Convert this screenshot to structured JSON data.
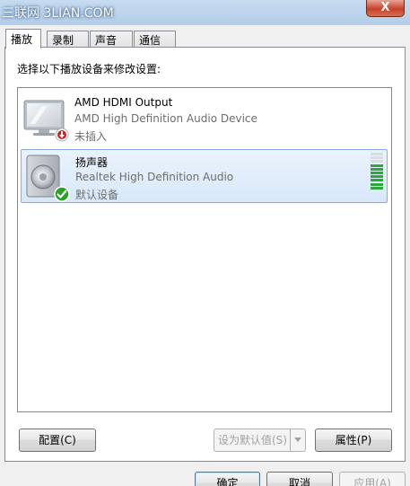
{
  "window": {
    "title": "三联网 3LIAN.COM",
    "close_glyph": "X"
  },
  "tabs": [
    {
      "label": "播放",
      "active": true
    },
    {
      "label": "录制",
      "active": false
    },
    {
      "label": "声音",
      "active": false
    },
    {
      "label": "通信",
      "active": false
    }
  ],
  "playback": {
    "instruction": "选择以下播放设备来修改设置:",
    "devices": [
      {
        "name": "AMD HDMI Output",
        "description": "AMD High Definition Audio Device",
        "status": "未插入",
        "icon": "monitor-icon",
        "badge": "unplugged-badge-icon",
        "selected": false
      },
      {
        "name": "扬声器",
        "description": "Realtek High Definition Audio",
        "status": "默认设备",
        "icon": "speaker-icon",
        "badge": "default-check-badge-icon",
        "selected": true,
        "level": 0.7
      }
    ],
    "configure_button": "配置(C)",
    "set_default_button": "设为默认值(S)",
    "properties_button": "属性(P)"
  },
  "footer": {
    "ok_button": "确定",
    "cancel_button": "取消",
    "apply_button": "应用(A)"
  },
  "colors": {
    "selection_border": "#84acdd",
    "level_on": "#2ea83a",
    "badge_check": "#2aa02a",
    "badge_unplugged": "#d02020"
  }
}
